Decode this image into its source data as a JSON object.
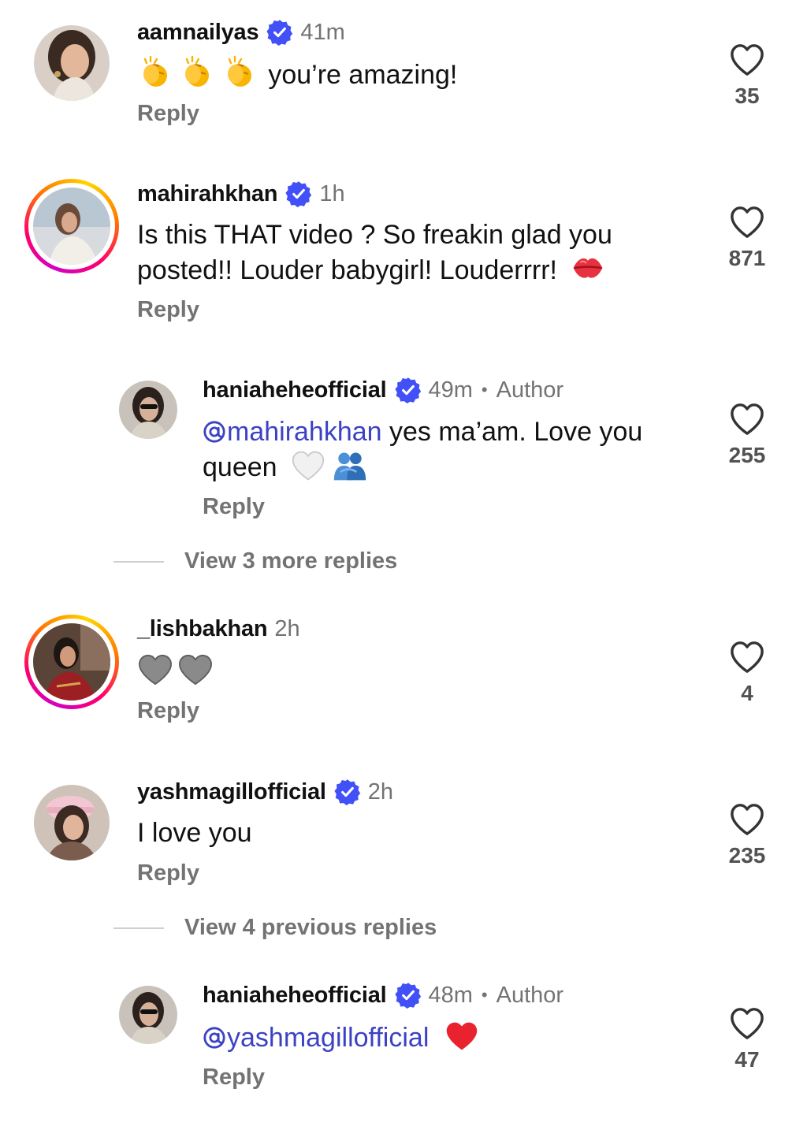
{
  "comments": [
    {
      "username": "aamnailyas",
      "time": "41m",
      "text": "you’re amazing!",
      "emoji_prefix": [
        "clapping-hands",
        "clapping-hands",
        "clapping-hands"
      ],
      "reply_label": "Reply",
      "likes": "35",
      "verified": true
    },
    {
      "username": "mahirahkhan",
      "time": "1h",
      "text_line1": "Is this THAT video ? So freakin glad you",
      "text_line2": "posted!! Louder babygirl! Louderrrr!",
      "emoji_suffix": "kiss-mark",
      "reply_label": "Reply",
      "likes": "871",
      "verified": true
    },
    {
      "username": "haniaheheofficial",
      "time": "49m",
      "author_label": "Author",
      "mention": "mahirahkhan",
      "text_line1": " yes ma’am. Love you",
      "text_line2": "queen",
      "emoji_suffix": [
        "white-heart",
        "people-hugging"
      ],
      "reply_label": "Reply",
      "likes": "255",
      "verified": true
    },
    {
      "username": "_lishbakhan",
      "time": "2h",
      "emoji_only": [
        "grey-heart",
        "grey-heart"
      ],
      "reply_label": "Reply",
      "likes": "4",
      "verified": false
    },
    {
      "username": "yashmagillofficial",
      "time": "2h",
      "text": "I love you",
      "reply_label": "Reply",
      "likes": "235",
      "verified": true
    },
    {
      "username": "haniaheheofficial",
      "time": "48m",
      "author_label": "Author",
      "mention": "yashmagillofficial",
      "emoji_suffix": "red-heart",
      "reply_label": "Reply",
      "likes": "47",
      "verified": true
    }
  ],
  "view_more_1": "View 3 more replies",
  "view_more_2": "View 4 previous replies",
  "colors": {
    "mention": "#3c42c4",
    "verified": "#4150f7",
    "muted": "#737373"
  },
  "icons": {
    "like": "heart-outline-icon",
    "verified": "verified-badge-icon",
    "mention_prefix": "at-sign-icon"
  }
}
